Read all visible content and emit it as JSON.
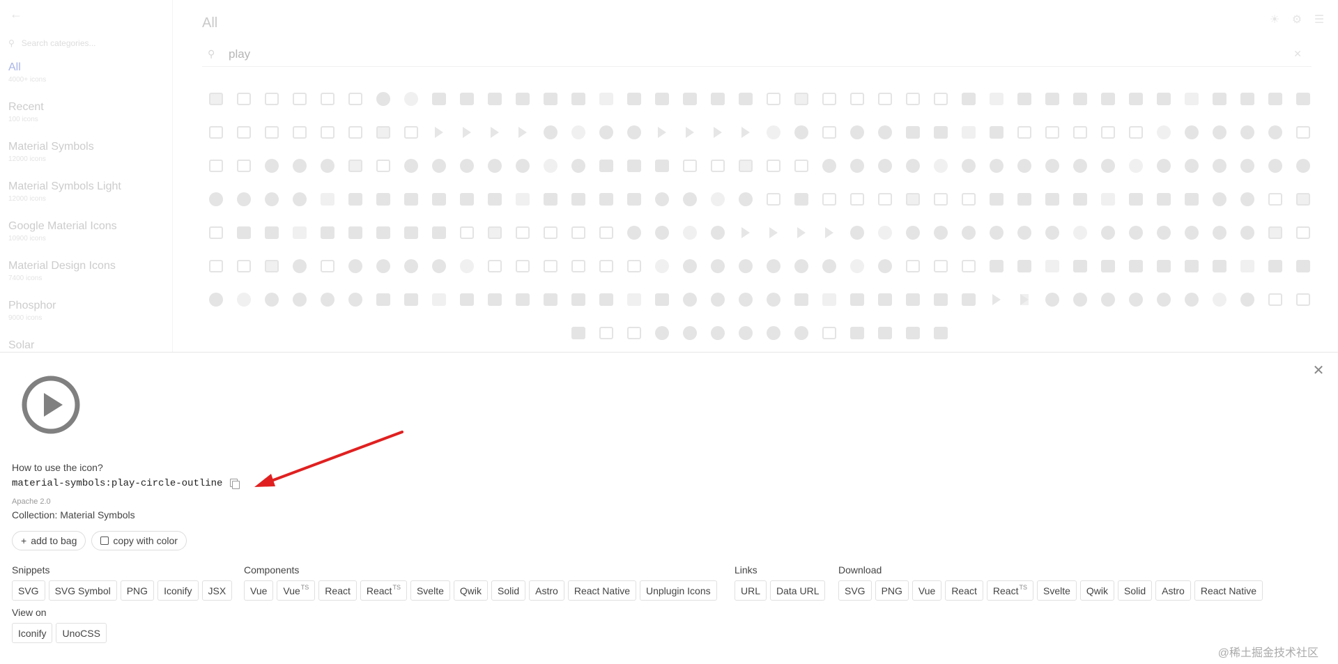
{
  "sidebar": {
    "search_placeholder": "Search categories...",
    "categories": [
      {
        "title": "All",
        "count": "4000+ icons"
      },
      {
        "title": "Recent",
        "count": "100 icons"
      },
      {
        "title": "Material Symbols",
        "count": "12000 icons"
      },
      {
        "title": "Material Symbols Light",
        "count": "12000 icons"
      },
      {
        "title": "Google Material Icons",
        "count": "10900 icons"
      },
      {
        "title": "Material Design Icons",
        "count": "7400 icons"
      },
      {
        "title": "Phosphor",
        "count": "9000 icons"
      },
      {
        "title": "Solar",
        "count": ""
      }
    ]
  },
  "main": {
    "title": "All",
    "search_value": "play"
  },
  "detail": {
    "how_label": "How to use the icon?",
    "icon_id": "material-symbols:play-circle-outline",
    "license": "Apache 2.0",
    "collection": "Collection: Material Symbols",
    "add_to_bag": "add to bag",
    "copy_with_color": "copy with color",
    "snippets": {
      "label": "Snippets",
      "items": [
        "SVG",
        "SVG Symbol",
        "PNG",
        "Iconify",
        "JSX"
      ]
    },
    "components": {
      "label": "Components",
      "items": [
        "Vue",
        "Vue",
        "React",
        "React",
        "Svelte",
        "Qwik",
        "Solid",
        "Astro",
        "React Native",
        "Unplugin Icons"
      ]
    },
    "links": {
      "label": "Links",
      "items": [
        "URL",
        "Data URL"
      ]
    },
    "download": {
      "label": "Download",
      "items": [
        "SVG",
        "PNG",
        "Vue",
        "React",
        "React",
        "Svelte",
        "Qwik",
        "Solid",
        "Astro",
        "React Native"
      ]
    },
    "view_on": {
      "label": "View on",
      "items": [
        "Iconify",
        "UnoCSS"
      ]
    },
    "ts_sup": "TS"
  },
  "watermark": "@稀土掘金技术社区",
  "colors": {
    "accent": "#a9b5e8",
    "arrow": "#e02020",
    "preview_icon": "#808080"
  }
}
